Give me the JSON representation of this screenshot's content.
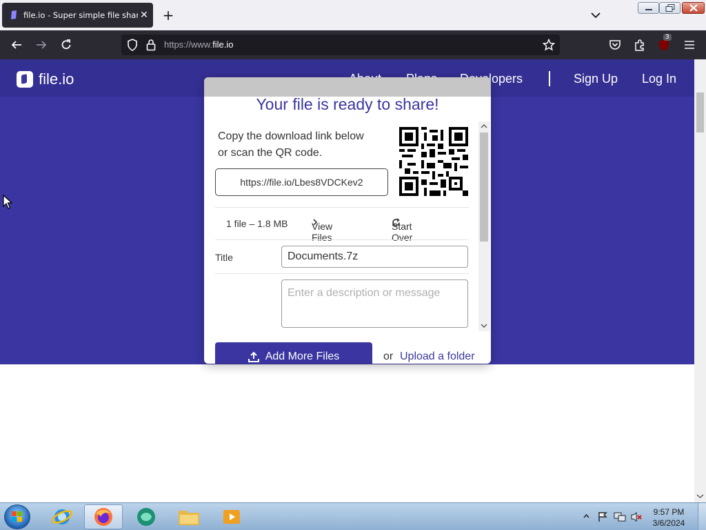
{
  "browser": {
    "tab_title": "file.io - Super simple file sharing",
    "new_tab_symbol": "+",
    "close_tab_symbol": "✕",
    "url_prefix": "https://www.",
    "url_domain": "file.io",
    "extension_badge": "3"
  },
  "site": {
    "logo_text": "file.io",
    "nav": {
      "about": "About",
      "plans": "Plans",
      "developers": "Developers",
      "signup": "Sign Up",
      "login": "Log In"
    }
  },
  "card": {
    "heading": "Your file is ready to share!",
    "instructions_line1": "Copy the download link below",
    "instructions_line2": "or scan the QR code.",
    "link": "https://file.io/Lbes8VDCKev2",
    "file_summary": "1 file – 1.8 MB",
    "view_files": "View Files",
    "start_over": "Start Over",
    "title_label": "Title",
    "title_value": "Documents.7z",
    "description_placeholder": "Enter a description or message",
    "add_more_files": "Add More Files",
    "or": "or",
    "upload_folder": "Upload a folder"
  },
  "taskbar": {
    "time": "9:57 PM",
    "date": "3/6/2024"
  },
  "colors": {
    "brand": "#3a35a0",
    "browser_dark": "#2b2a33"
  },
  "icons": [
    "firefox-icon",
    "plus-icon",
    "close-icon",
    "chevron-down-icon",
    "back-icon",
    "forward-icon",
    "reload-icon",
    "shield-icon",
    "lock-icon",
    "star-icon",
    "pocket-icon",
    "extensions-icon",
    "ublock-icon",
    "menu-icon",
    "qr-code-icon",
    "chevron-right-icon",
    "refresh-icon",
    "upload-icon",
    "windows-start-icon",
    "ie-icon",
    "file-explorer-icon",
    "media-player-icon"
  ]
}
